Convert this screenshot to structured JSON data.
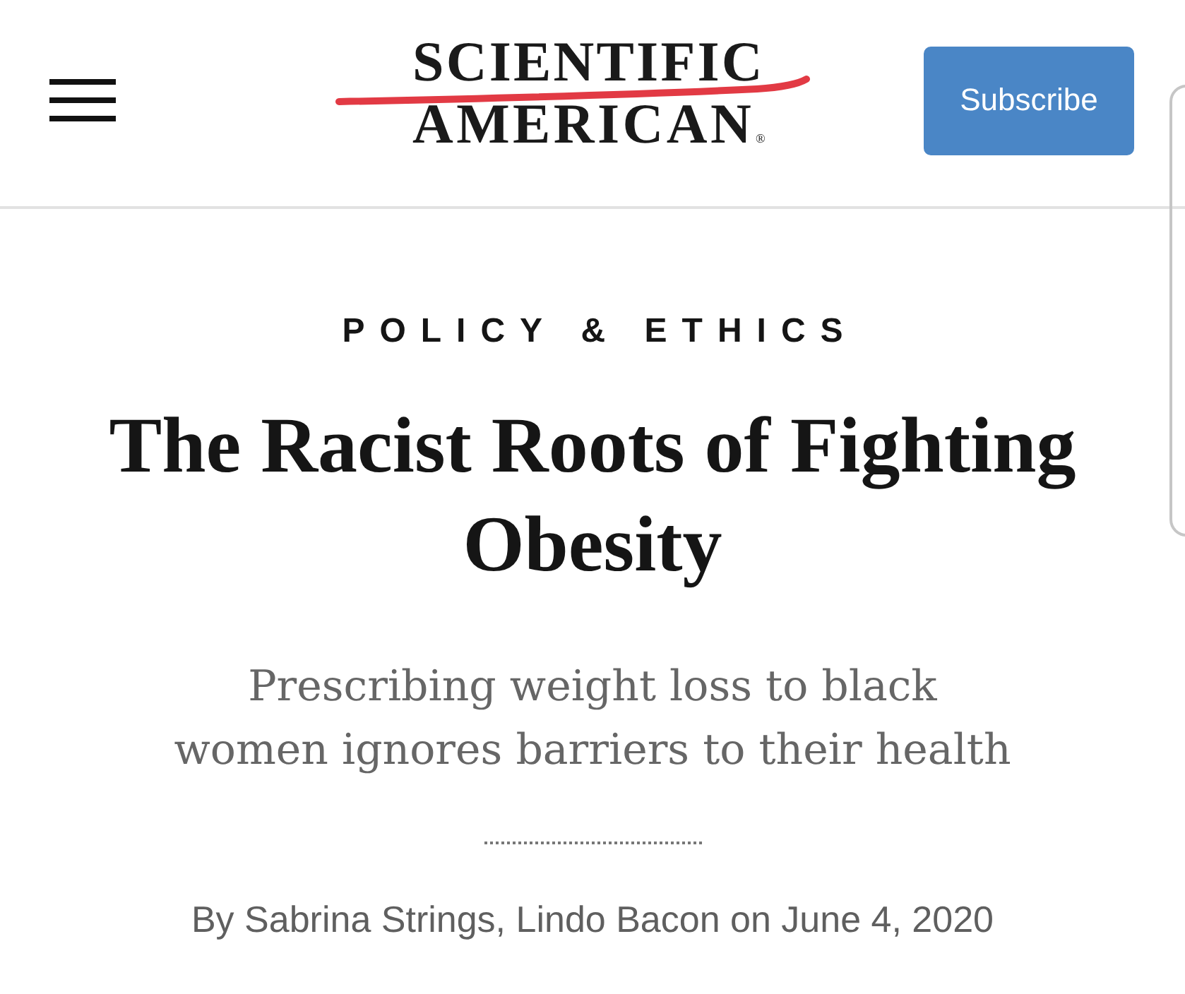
{
  "header": {
    "logo": {
      "lines": [
        "SCIENTIFIC",
        "AMERICAN"
      ],
      "mark": "®"
    },
    "subscribe_button": "Subscribe"
  },
  "article": {
    "category": "POLICY & ETHICS",
    "title": "The Racist Roots of Fighting Obesity",
    "subtitle_lines": [
      "Prescribing weight loss to black",
      "women ignores barriers to their health"
    ],
    "byline": "By Sabrina Strings, Lindo Bacon on June 4, 2020"
  }
}
